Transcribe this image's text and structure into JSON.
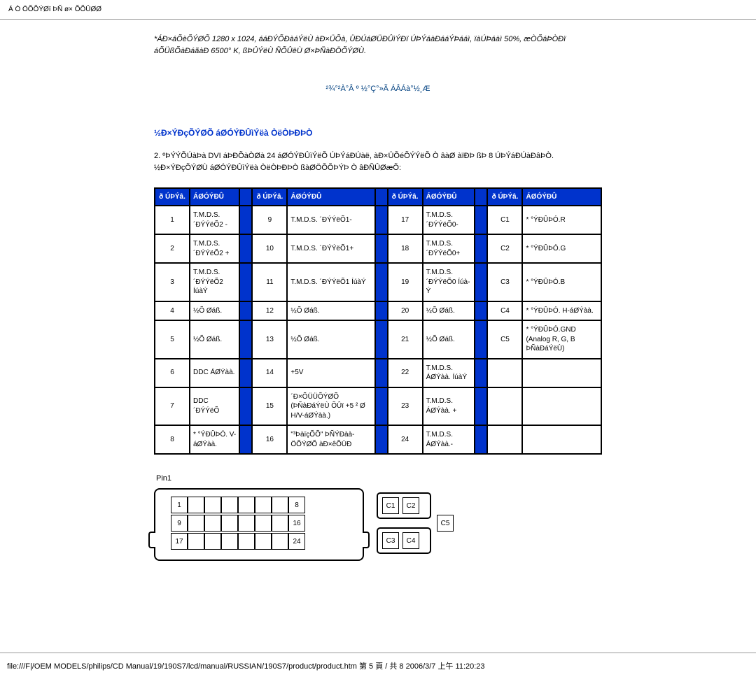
{
  "page_header": "Á Ò ÖÕÕÝØï ÞÑ ø× ÕÕÛØØ",
  "intro_note": "*ÁÐ×áÕèÕÝØÕ 1280 x 1024, ááÐÝÕÐàáÝëÙ àÐ×ÜÕà, ÜÐÚáØÜÐÛìÝÐï ÚÞÝáàÐááÝÞááì, ïàÚÞáàì 50%, æÒÕáÞÒÐï áÕÜßÕàÐáãàÐ 6500° K, ßÞÛÝëÙ ÑÕÛëÙ Ø×ÞÑàÐÖÕÝØÙ.",
  "back_link": "²¾°²À°Â º ½°Ç°»Ã ÁÂÁà°½¸Æ",
  "section_title": "½Ð×ÝÐçÕÝØÕ áØÓÝÐÛìÝëà ÒëÒÞÐÞÒ",
  "section_desc": "2. ºÞÝÝÕÚàÞà DVI áÞÐÕàÒØà 24 áØÓÝÐÛìÝëÕ ÚÞÝáÐÚàë, àÐ×ÜÕéÕÝÝëÕ Ò âàØ àïÐÞ ßÞ 8 ÚÞÝáÐÚàÐâÞÒ. ½Ð×ÝÐçÕÝØÙ áØÓÝÐÛìÝëà ÒëÒÞÐÞÒ ßàØÖÕÕÞÝÞ Ò âÐÑÛØæÕ:",
  "head_num": "ð ÚÞÝâ.",
  "head_sig": "ÁØÓÝÐÛ",
  "rows": [
    {
      "n1": "1",
      "s1": "T.M.D.S. ´ÐÝÝëÕ2 -",
      "n2": "9",
      "s2": "T.M.D.S. ´ÐÝÝëÕ1-",
      "n3": "17",
      "s3": "T.M.D.S. ´ÐÝÝëÕ0-",
      "n4": "C1",
      "s4": "* °ÝÐÛÞÓ.R"
    },
    {
      "n1": "2",
      "s1": "T.M.D.S. ´ÐÝÝëÕ2 +",
      "n2": "10",
      "s2": "T.M.D.S. ´ÐÝÝëÕ1+",
      "n3": "18",
      "s3": "T.M.D.S. ´ÐÝÝëÕ0+",
      "n4": "C2",
      "s4": "* °ÝÐÛÞÓ.G"
    },
    {
      "n1": "3",
      "s1": "T.M.D.S. ´ÐÝÝëÕ2 Íúà­Ý",
      "n2": "11",
      "s2": "T.M.D.S. ´ÐÝÝëÕ1 Íúà­Ý",
      "n3": "19",
      "s3": "T.M.D.S. ´ÐÝÝëÕ0 Íúà­Ý",
      "n4": "C3",
      "s4": "* °ÝÐÛÞÓ.B"
    },
    {
      "n1": "4",
      "s1": "½Õ Øáß.",
      "n2": "12",
      "s2": "½Õ Øáß.",
      "n3": "20",
      "s3": "½Õ Øáß.",
      "n4": "C4",
      "s4": "* °ÝÐÛÞÓ. H-áØÝàà."
    },
    {
      "n1": "5",
      "s1": "½Õ Øáß.",
      "n2": "13",
      "s2": "½Õ Øáß.",
      "n3": "21",
      "s3": "½Õ Øáß.",
      "n4": "C5",
      "s4": "* °ÝÐÛÞÓ.GND (Analog R, G, B ÞÑàÐáÝëÙ)"
    },
    {
      "n1": "6",
      "s1": "DDC ÁØÝàà.",
      "n2": "14",
      "s2": "+5V",
      "n3": "22",
      "s3": "T.M.D.S. ÁØÝàà. Íúà­Ý",
      "n4": "",
      "s4": ""
    },
    {
      "n1": "7",
      "s1": "DDC ´ÐÝÝëÕ",
      "n2": "15",
      "s2": "´Ð×ÕÜÜÕÝØÕ (ÞÑàÐáÝëÙ ÕÛï +5 ² Ø H/V-áØÝàà.)",
      "n3": "23",
      "s3": "T.M.D.S. ÁØÝàà. +",
      "n4": "",
      "s4": ""
    },
    {
      "n1": "8",
      "s1": "* °ÝÐÛÞÓ. V-áØÝàà.",
      "n2": "16",
      "s2": "\"³ÞàïçÕÕ\" ÞÑÝÐàà-ÖÕÝØÕ àÐ×êÕÜÐ",
      "n3": "24",
      "s3": "T.M.D.S. ÁØÝàà.-",
      "n4": "",
      "s4": ""
    }
  ],
  "pin1_label": "Pin1",
  "conn_left_labels": {
    "r1": "8",
    "r2": "16",
    "r3": "24"
  },
  "conn_right_labels": {
    "r1": "1",
    "r2": "9",
    "r3": "17"
  },
  "c_labels": {
    "c1": "C1",
    "c2": "C2",
    "c3": "C3",
    "c4": "C4",
    "c5": "C5"
  },
  "footer": "file:///F|/OEM MODELS/philips/CD Manual/19/190S7/lcd/manual/RUSSIAN/190S7/product/product.htm 第 5 頁 / 共 8 2006/3/7 上午 11:20:23"
}
